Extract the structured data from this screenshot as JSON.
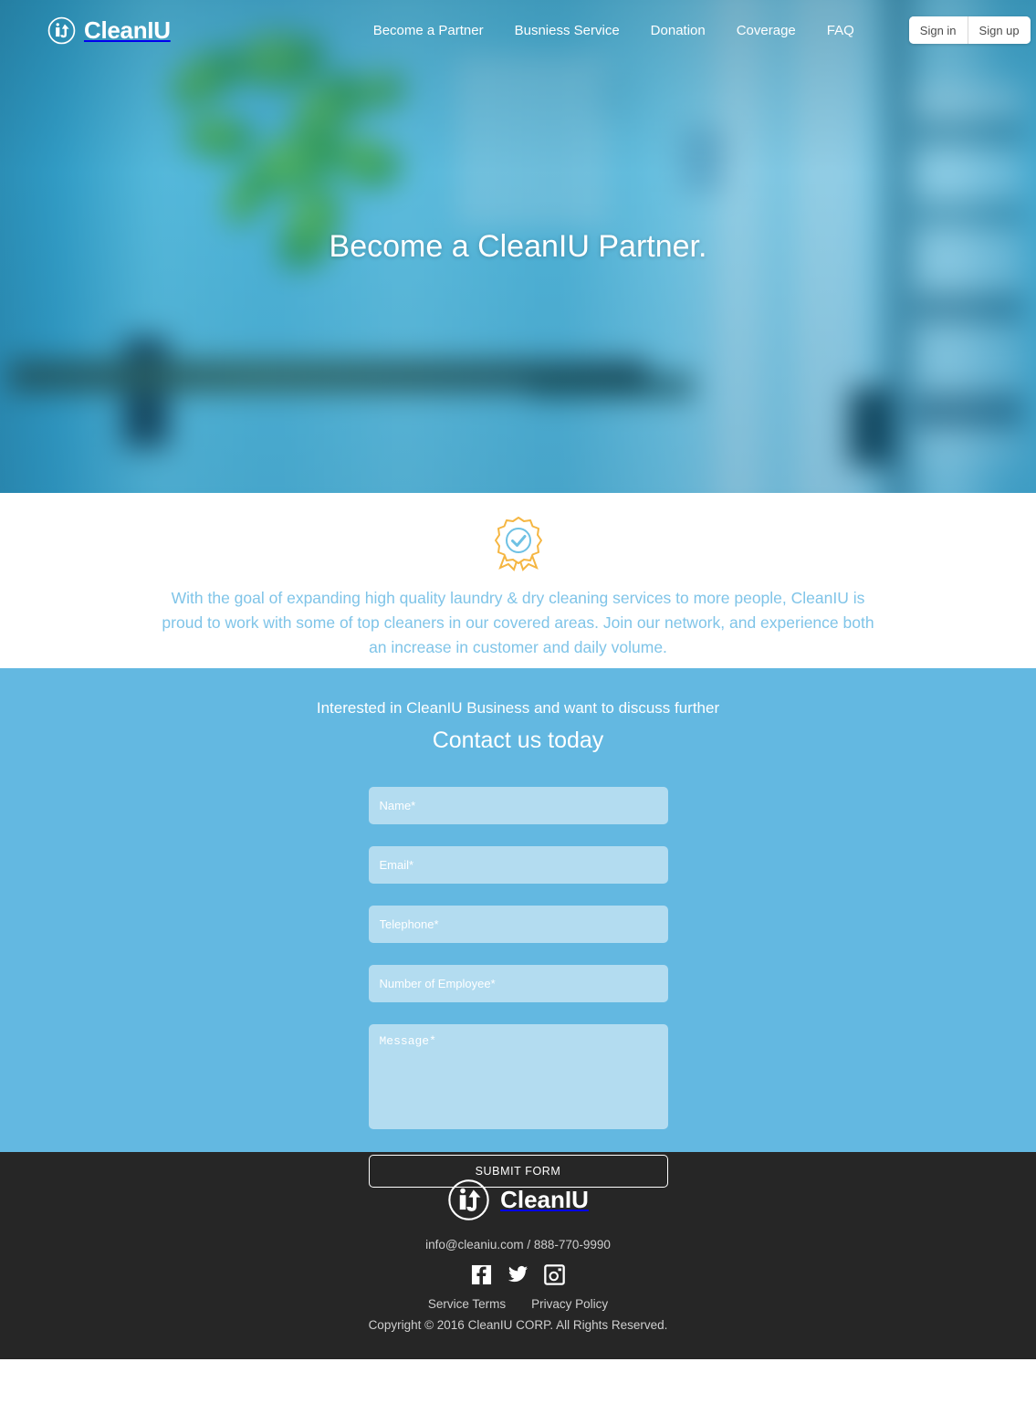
{
  "colors": {
    "hero_overlay_blue": "#2d8bb5",
    "contact_bg": "#63b8e1",
    "input_bg": "#b3dcf0",
    "intro_text": "#7fc4e8",
    "footer_bg": "#262626",
    "badge_gold": "#f5b642",
    "badge_blue": "#6ec1e4"
  },
  "navbar": {
    "brand": "CleanIU",
    "brand_icon": "cleaniu-logo-icon",
    "links": [
      {
        "label": "Become a Partner"
      },
      {
        "label": "Busniess Service"
      },
      {
        "label": "Donation"
      },
      {
        "label": "Coverage"
      },
      {
        "label": "FAQ"
      }
    ],
    "sign_in": "Sign in",
    "sign_up": "Sign up"
  },
  "hero": {
    "title": "Become a CleanIU Partner."
  },
  "intro": {
    "icon": "award-badge-check-icon",
    "paragraph": "With the goal of expanding high quality laundry & dry cleaning services to more people, CleanIU is proud to work with some of top cleaners in our covered areas. Join our network, and experience both an increase in customer and daily volume."
  },
  "contact": {
    "subtitle": "Interested in CleanIU Business and want to discuss further",
    "title": "Contact us today",
    "fields": [
      {
        "name": "name",
        "placeholder": "Name*",
        "value": ""
      },
      {
        "name": "email",
        "placeholder": "Email*",
        "value": ""
      },
      {
        "name": "telephone",
        "placeholder": "Telephone*",
        "value": ""
      },
      {
        "name": "employees",
        "placeholder": "Number of Employee*",
        "value": ""
      }
    ],
    "message_placeholder": "Message*",
    "message_value": "",
    "submit_label": "SUBMIT FORM"
  },
  "footer": {
    "brand": "CleanIU",
    "brand_icon": "cleaniu-logo-icon",
    "contact": "info@cleaniu.com / 888-770-9990",
    "socials": [
      {
        "name": "facebook-icon"
      },
      {
        "name": "twitter-icon"
      },
      {
        "name": "instagram-icon"
      }
    ],
    "links": [
      {
        "label": "Service Terms"
      },
      {
        "label": "Privacy Policy"
      }
    ],
    "copyright": "Copyright © 2016 CleanIU CORP. All Rights Reserved."
  }
}
